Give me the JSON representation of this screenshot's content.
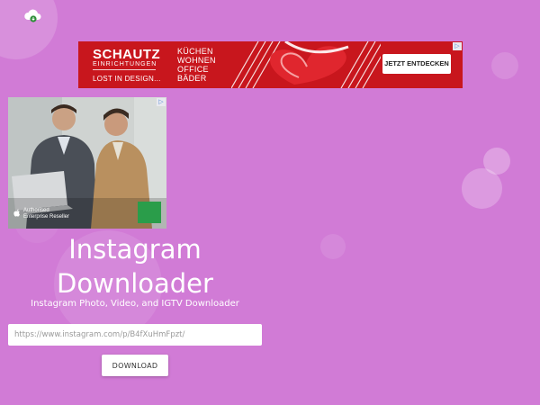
{
  "colors": {
    "background": "#d17bd6",
    "ad_red": "#c8161d",
    "text_light": "#ffffff"
  },
  "header": {
    "logo_icon": "cloud-download-icon"
  },
  "banner_ad": {
    "brand": "SCHAUTZ",
    "brand_sub": "EINRICHTUNGEN",
    "tagline": "LOST IN DESIGN...",
    "words": [
      "KÜCHEN",
      "WOHNEN",
      "OFFICE",
      "BÄDER"
    ],
    "cta": "JETZT ENTDECKEN",
    "adchoices_icon": "ad-choices-icon"
  },
  "square_ad": {
    "caption_line1": "Authorised",
    "caption_line2": "Enterprise Reseller",
    "apple_icon": "apple-logo-icon",
    "adchoices_icon": "ad-choices-icon"
  },
  "main": {
    "title_line1": "Instagram",
    "title_line2": "Downloader",
    "subtitle": "Instagram Photo, Video, and IGTV Downloader",
    "url_placeholder": "https://www.instagram.com/p/B4fXuHmFpzt/",
    "download_label": "DOWNLOAD"
  }
}
